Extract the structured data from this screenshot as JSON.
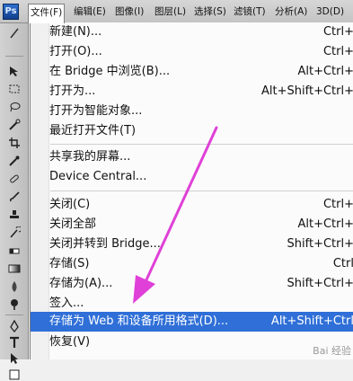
{
  "app": {
    "logo": "Ps"
  },
  "menubar": {
    "items": [
      {
        "label": "文件(F)"
      },
      {
        "label": "编辑(E)"
      },
      {
        "label": "图像(I)"
      },
      {
        "label": "图层(L)"
      },
      {
        "label": "选择(S)"
      },
      {
        "label": "滤镜(T)"
      },
      {
        "label": "分析(A)"
      },
      {
        "label": "3D(D)"
      }
    ]
  },
  "file_menu": {
    "items": [
      {
        "label": "新建(N)...",
        "shortcut": "Ctrl+"
      },
      {
        "label": "打开(O)...",
        "shortcut": "Ctrl+"
      },
      {
        "label": "在 Bridge 中浏览(B)...",
        "shortcut": "Alt+Ctrl+"
      },
      {
        "label": "打开为...",
        "shortcut": "Alt+Shift+Ctrl+"
      },
      {
        "label": "打开为智能对象...",
        "shortcut": ""
      },
      {
        "label": "最近打开文件(T)",
        "shortcut": ""
      },
      {
        "label": "共享我的屏幕...",
        "shortcut": ""
      },
      {
        "label": "Device Central...",
        "shortcut": ""
      },
      {
        "label": "关闭(C)",
        "shortcut": "Ctrl+"
      },
      {
        "label": "关闭全部",
        "shortcut": "Alt+Ctrl+"
      },
      {
        "label": "关闭并转到 Bridge...",
        "shortcut": "Shift+Ctrl+"
      },
      {
        "label": "存储(S)",
        "shortcut": "Ctrl"
      },
      {
        "label": "存储为(A)...",
        "shortcut": "Shift+Ctrl+"
      },
      {
        "label": "签入...",
        "shortcut": ""
      },
      {
        "label": "存储为 Web 和设备所用格式(D)...",
        "shortcut": "Alt+Shift+Ctrl"
      },
      {
        "label": "恢复(V)",
        "shortcut": ""
      }
    ],
    "highlighted": "存储为 Web 和设备所用格式(D)...",
    "arrow_color": "#e040d8",
    "highlight_color": "#2f6fd7"
  },
  "watermark": "Bai 经验"
}
